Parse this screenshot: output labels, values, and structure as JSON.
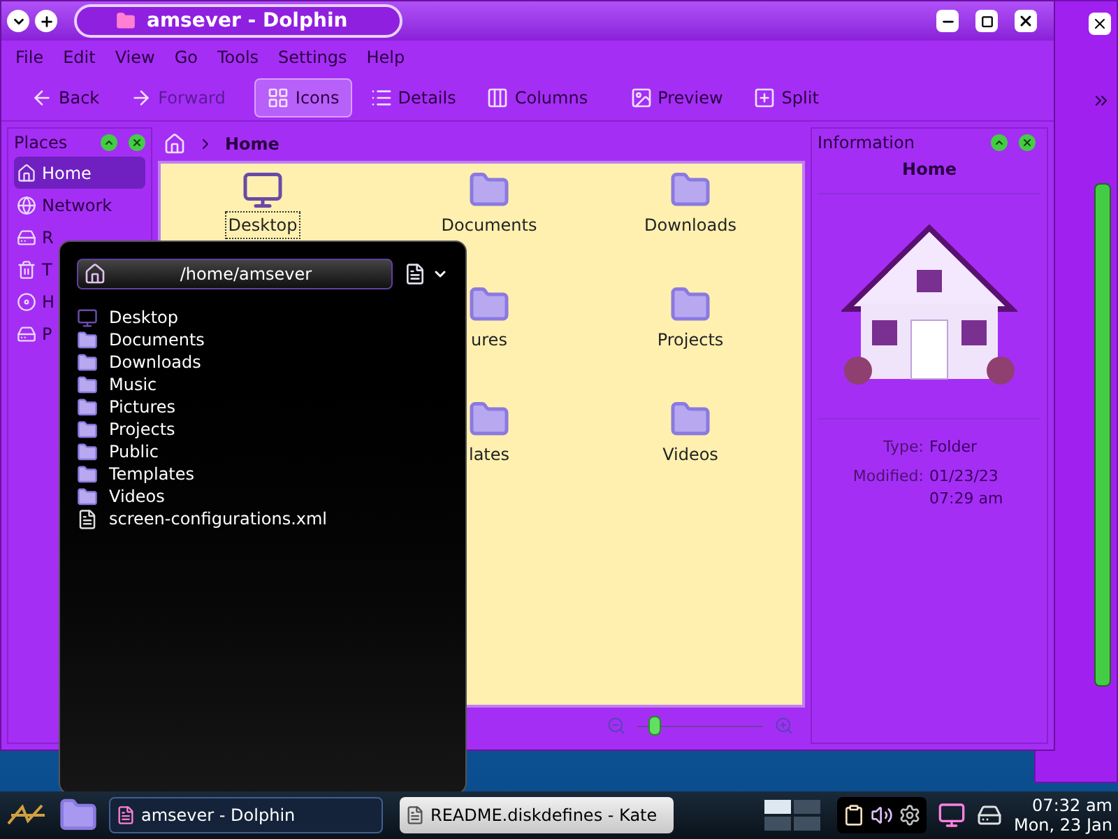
{
  "window": {
    "title": "amsever - Dolphin"
  },
  "menu": [
    "File",
    "Edit",
    "View",
    "Go",
    "Tools",
    "Settings",
    "Help"
  ],
  "toolbar": [
    {
      "label": "Back",
      "kind": "back",
      "disabled": false
    },
    {
      "label": "Forward",
      "kind": "forward",
      "disabled": true
    },
    {
      "label": "Icons",
      "kind": "icons",
      "selected": true
    },
    {
      "label": "Details",
      "kind": "details",
      "selected": false
    },
    {
      "label": "Columns",
      "kind": "columns",
      "selected": false
    },
    {
      "label": "Preview",
      "kind": "preview"
    },
    {
      "label": "Split",
      "kind": "split"
    }
  ],
  "places": {
    "title": "Places",
    "items": [
      {
        "label": "Home",
        "kind": "home",
        "selected": true
      },
      {
        "label": "Network",
        "kind": "network",
        "selected": false
      },
      {
        "label": "R",
        "kind": "drive",
        "selected": false
      },
      {
        "label": "T",
        "kind": "trash",
        "selected": false
      },
      {
        "label": "H",
        "kind": "disk",
        "selected": false
      },
      {
        "label": "P",
        "kind": "drive",
        "selected": false
      }
    ]
  },
  "breadcrumb": {
    "current": "Home"
  },
  "files": [
    {
      "items": [
        {
          "label": "Desktop",
          "kind": "desktop",
          "focused": true
        },
        {
          "label": "Documents",
          "kind": "folder",
          "focused": false
        },
        {
          "label": "Downloads",
          "kind": "folder",
          "focused": false
        }
      ]
    },
    {
      "items": [
        {
          "label": "ures",
          "kind": "folder",
          "focused": false
        },
        {
          "label": "Projects",
          "kind": "folder",
          "focused": false
        }
      ]
    },
    {
      "items": [
        {
          "label": "lates",
          "kind": "folder",
          "focused": false
        },
        {
          "label": "Videos",
          "kind": "folder",
          "focused": false
        }
      ]
    }
  ],
  "info": {
    "title": "Information",
    "name": "Home",
    "fields": [
      {
        "label": "Type:",
        "value": "Folder"
      },
      {
        "label": "Modified:",
        "value": "01/23/23 07:29 am"
      }
    ]
  },
  "zoom": {
    "level": 0.1
  },
  "popup": {
    "path": "/home/amsever",
    "items": [
      {
        "label": "Desktop",
        "kind": "desktop"
      },
      {
        "label": "Documents",
        "kind": "folder"
      },
      {
        "label": "Downloads",
        "kind": "folder"
      },
      {
        "label": "Music",
        "kind": "folder"
      },
      {
        "label": "Pictures",
        "kind": "folder"
      },
      {
        "label": "Projects",
        "kind": "folder"
      },
      {
        "label": "Public",
        "kind": "folder"
      },
      {
        "label": "Templates",
        "kind": "folder"
      },
      {
        "label": "Videos",
        "kind": "folder"
      },
      {
        "label": "screen-configurations.xml",
        "kind": "file"
      }
    ]
  },
  "taskbar": {
    "tasks": [
      {
        "label": "amsever - Dolphin",
        "selected": true
      },
      {
        "label": "README.diskdefines - Kate",
        "selected": false
      }
    ],
    "time": "07:32 am",
    "date": "Mon, 23 Jan"
  }
}
